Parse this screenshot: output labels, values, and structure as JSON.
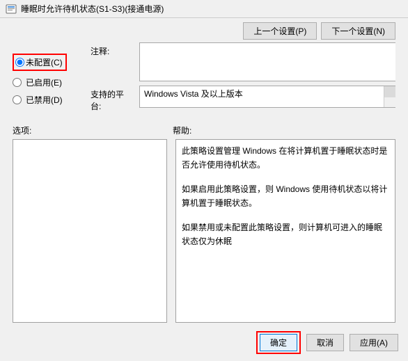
{
  "window": {
    "title": "睡眠时允许待机状态(S1-S3)(接通电源)"
  },
  "nav": {
    "prev": "上一个设置(P)",
    "next": "下一个设置(N)"
  },
  "radios": {
    "not_configured": "未配置(C)",
    "enabled": "已启用(E)",
    "disabled": "已禁用(D)"
  },
  "labels": {
    "comment": "注释:",
    "platform": "支持的平台:",
    "options": "选项:",
    "help": "帮助:"
  },
  "platform_text": "Windows Vista 及以上版本",
  "help": {
    "p1": "此策略设置管理 Windows 在将计算机置于睡眠状态时是否允许使用待机状态。",
    "p2": "如果启用此策略设置，则 Windows 使用待机状态以将计算机置于睡眠状态。",
    "p3": "如果禁用或未配置此策略设置，则计算机可进入的睡眠状态仅为休眠"
  },
  "buttons": {
    "ok": "确定",
    "cancel": "取消",
    "apply": "应用(A)"
  }
}
